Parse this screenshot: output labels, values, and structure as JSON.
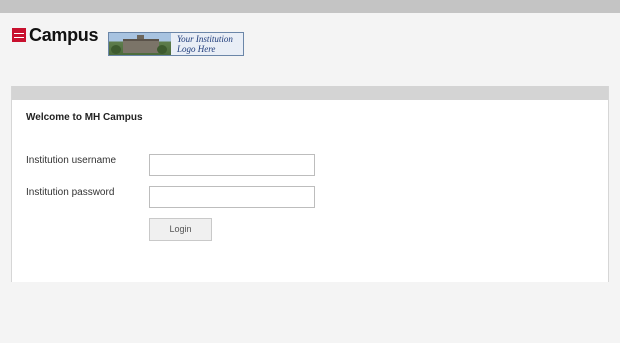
{
  "header": {
    "brand_name": "Campus",
    "brand_icon": "mh-logo-icon",
    "institution_logo": {
      "line1": "Your Institution",
      "line2": "Logo Here"
    }
  },
  "panel": {
    "title": "Welcome to MH Campus",
    "username_label": "Institution username",
    "username_value": "",
    "password_label": "Institution password",
    "password_value": "",
    "login_label": "Login"
  },
  "colors": {
    "topbar": "#c4c4c4",
    "panel_bar": "#d4d4d4",
    "brand_red": "#c8102e",
    "logo_text": "#1e3b7a"
  }
}
